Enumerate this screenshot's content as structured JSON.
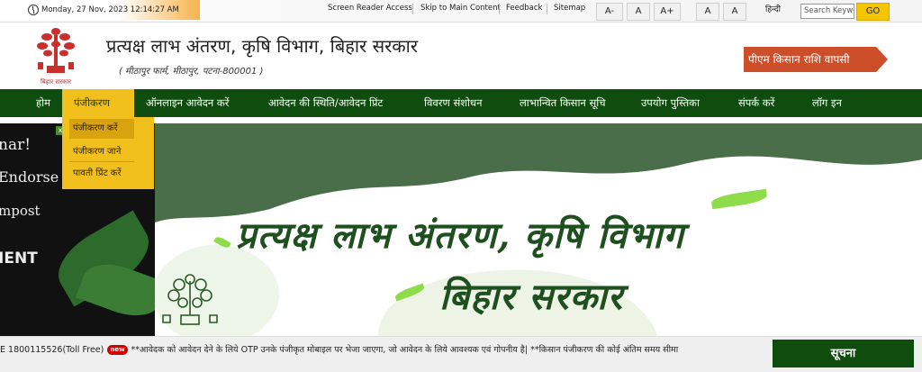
{
  "topbar": {
    "datetime": "Monday, 27 Nov, 2023 12:14:27 AM",
    "links": [
      "Screen Reader Access",
      "Skip to Main Content",
      "Feedback",
      "Sitemap"
    ],
    "font_buttons": [
      "A-",
      "A",
      "A+"
    ],
    "contrast_buttons": [
      "A",
      "A"
    ],
    "language": "हिन्दी",
    "search_placeholder": "Search Keywo",
    "go_label": "GO"
  },
  "header": {
    "logo_caption": "बिहार सरकार",
    "title": "प्रत्यक्ष लाभ अंतरण, कृषि विभाग, बिहार सरकार",
    "subtitle": "( मीठापुर फार्म, मीठापुर, पटना-800001 )",
    "refund_button": "पीएम किसान राशि वापसी"
  },
  "nav": {
    "items": [
      "होम",
      "पंजीकरण",
      "ऑनलाइन आवेदन करें",
      "आवेदन की स्थिति/आवेदन प्रिंट",
      "विवरण संशोधन",
      "लाभान्वित किसान सूचि",
      "उपयोग पुस्तिका",
      "संपर्क करें",
      "लॉग इन"
    ],
    "active_index": 1,
    "dropdown": [
      "पंजीकरण करें",
      "पंजीकरण जाने",
      "पावती प्रिंट करें"
    ]
  },
  "banner": {
    "left_lines": [
      "nar!",
      "Endorse",
      "mpost",
      "IENT"
    ],
    "hero_title": "प्रत्यक्ष लाभ अंतरण, कृषि विभाग",
    "hero_subtitle": "बिहार सरकार",
    "close_label": "x"
  },
  "ticker": {
    "prefix": "E 1800115526(Toll Free)",
    "badge": "new",
    "message": "**आवेदक को आवेदन देने के लिये OTP उनके पंजीकृत मोबाइल पर भेजा जाएगा, जो आवेदन के लिये आवश्यक एवं गोपनीय है| **किसान पंजीकरण की कोई अंतिम समय सीमा",
    "notice_button": "सूचना"
  },
  "colors": {
    "nav_green": "#0f4d0f",
    "accent_yellow": "#f2c01d",
    "refund_red": "#cd4f2a",
    "hero_green": "#1e4f1e"
  }
}
